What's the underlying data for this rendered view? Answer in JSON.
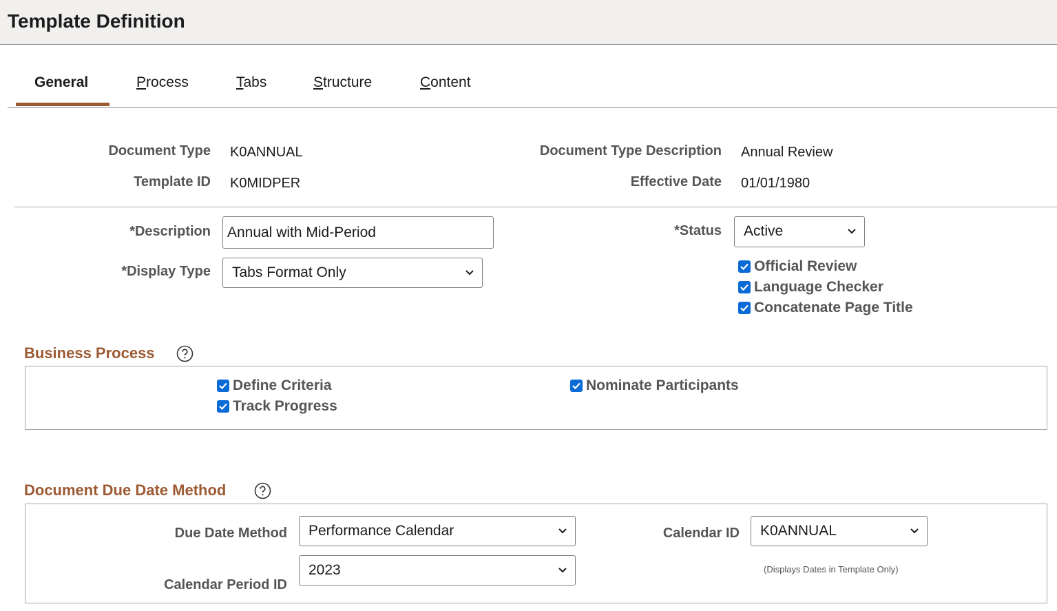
{
  "page": {
    "title": "Template Definition"
  },
  "tabs": [
    {
      "label_prefix": "",
      "accel": "",
      "label_rest": "General",
      "active": true
    },
    {
      "label_prefix": "",
      "accel": "P",
      "label_rest": "rocess",
      "active": false
    },
    {
      "label_prefix": "",
      "accel": "T",
      "label_rest": "abs",
      "active": false
    },
    {
      "label_prefix": "",
      "accel": "S",
      "label_rest": "tructure",
      "active": false
    },
    {
      "label_prefix": "",
      "accel": "C",
      "label_rest": "ontent",
      "active": false
    }
  ],
  "header_fields": {
    "document_type_label": "Document Type",
    "document_type_value": "K0ANNUAL",
    "template_id_label": "Template ID",
    "template_id_value": "K0MIDPER",
    "doc_type_desc_label": "Document Type Description",
    "doc_type_desc_value": "Annual Review",
    "effective_date_label": "Effective Date",
    "effective_date_value": "01/01/1980"
  },
  "form": {
    "description_label": "*Description",
    "description_value": "Annual with Mid-Period",
    "display_type_label": "*Display Type",
    "display_type_value": "Tabs Format Only",
    "status_label": "*Status",
    "status_value": "Active",
    "checkboxes": [
      {
        "label": "Official Review",
        "checked": true
      },
      {
        "label": "Language Checker",
        "checked": true
      },
      {
        "label": "Concatenate Page Title",
        "checked": true
      }
    ]
  },
  "business_process": {
    "title": "Business Process",
    "help_icon": "question-circle-icon",
    "items": [
      {
        "label": "Define Criteria",
        "checked": true
      },
      {
        "label": "Track Progress",
        "checked": true
      },
      {
        "label": "Nominate Participants",
        "checked": true
      }
    ]
  },
  "due_date": {
    "title": "Document Due Date Method",
    "help_icon": "question-circle-icon",
    "method_label": "Due Date Method",
    "method_value": "Performance Calendar",
    "calendar_id_label": "Calendar ID",
    "calendar_id_value": "K0ANNUAL",
    "period_label": "Calendar Period ID",
    "period_value": "2023",
    "note": "(Displays Dates in Template Only)"
  },
  "colors": {
    "accent": "#9c5a33",
    "checkbox": "#0b6bd6",
    "header_bg": "#f1f0ee"
  }
}
